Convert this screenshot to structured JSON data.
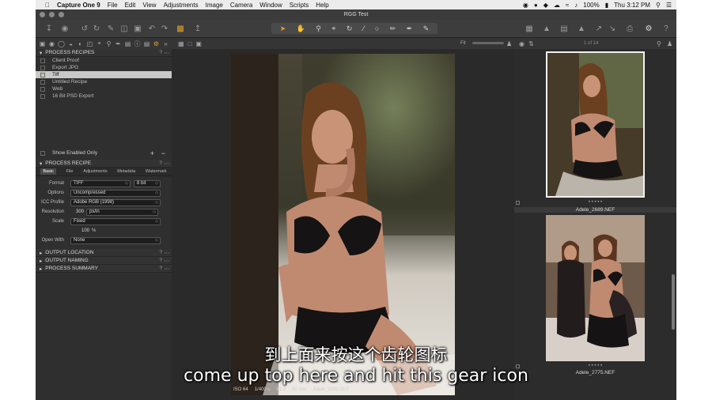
{
  "menubar": {
    "app_name": "Capture One 9",
    "items": [
      "File",
      "Edit",
      "View",
      "Adjustments",
      "Image",
      "Camera",
      "Window",
      "Scripts",
      "Help"
    ],
    "battery": "100%",
    "clock": "Thu 3:12 PM"
  },
  "window": {
    "title": "RGG Test"
  },
  "left_panel": {
    "process_recipes": {
      "header": "PROCESS RECIPES",
      "help": "?",
      "items": [
        {
          "label": "Client Proof",
          "checked": false
        },
        {
          "label": "Export JPG",
          "checked": false
        },
        {
          "label": "Tiff",
          "checked": true
        },
        {
          "label": "Untitled Recipe",
          "checked": false
        },
        {
          "label": "Web",
          "checked": false
        },
        {
          "label": "16 Bit PSD Export",
          "checked": false
        }
      ],
      "show_enabled": "Show Enabled Only",
      "add": "+",
      "remove": "−"
    },
    "process_recipe": {
      "header": "PROCESS RECIPE",
      "tabs": [
        "Basic",
        "File",
        "Adjustments",
        "Metadata",
        "Watermark"
      ],
      "format_label": "Format",
      "format_value": "TIFF",
      "bit_value": "8 bit",
      "options_label": "Options",
      "options_value": "Uncompressed",
      "icc_label": "ICC Profile",
      "icc_value": "Adobe RGB (1998)",
      "resolution_label": "Resolution",
      "resolution_value": "300",
      "resolution_unit": "px/in",
      "scale_label": "Scale",
      "scale_value": "Fixed",
      "scale_pct": "100",
      "pct": "%",
      "openwith_label": "Open With",
      "openwith_value": "None"
    },
    "collapsed": [
      "OUTPUT LOCATION",
      "OUTPUT NAMING",
      "PROCESS SUMMARY"
    ]
  },
  "viewer": {
    "fit_label": "Fit",
    "info": {
      "iso": "ISO 64",
      "shutter": "1/400 s",
      "aperture": "f/1.2",
      "focal": "85 mm",
      "file": "Adele_2689.NEF"
    }
  },
  "browser": {
    "count": "1 of 14",
    "thumbnails": [
      {
        "name": "Adele_2689.NEF",
        "selected": true
      },
      {
        "name": "Adele_2775.NEF",
        "selected": false
      }
    ]
  },
  "subtitles": {
    "zh": "到上面来按这个齿轮图标",
    "en": "come up top here and hit this gear icon"
  },
  "colors": {
    "accent": "#e6a129",
    "panel": "#2f2f2f",
    "toolbar": "#3d3d3d"
  }
}
